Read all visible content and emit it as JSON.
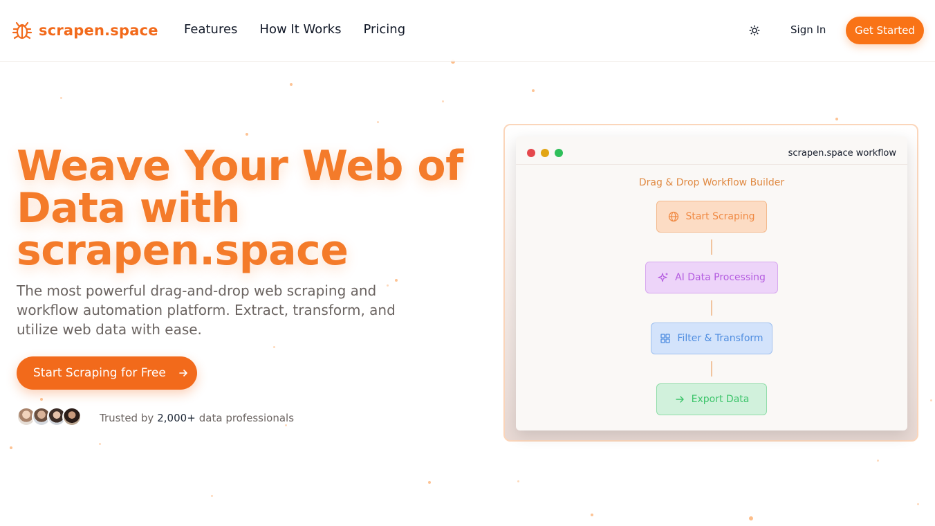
{
  "brand": {
    "name": "scrapen.space",
    "logo_icon": "bug-icon",
    "accent_color": "#f97316"
  },
  "nav": {
    "items": [
      {
        "label": "Features"
      },
      {
        "label": "How It Works"
      },
      {
        "label": "Pricing"
      }
    ]
  },
  "header_actions": {
    "theme_icon": "sun-icon",
    "sign_in_label": "Sign In",
    "get_started_label": "Get Started"
  },
  "hero": {
    "title_line1": "Weave Your Web of",
    "title_line2": "Data with",
    "title_line3": "scrapen.space",
    "subtitle": "The most powerful drag-and-drop web scraping and workflow automation platform. Extract, transform, and utilize web data with ease.",
    "cta_label": "Start Scraping for Free",
    "cta_icon": "arrow-right-icon",
    "trusted_prefix": "Trusted by",
    "trusted_count": "2,000+",
    "trusted_suffix": "data professionals"
  },
  "preview": {
    "window_title": "scrapen.space workflow",
    "builder_title": "Drag & Drop Workflow Builder",
    "window_dot_colors": [
      "#e5484d",
      "#e2a514",
      "#2fbf5a"
    ],
    "nodes": [
      {
        "label": "Start Scraping",
        "icon": "globe-icon",
        "color": "#f08a44"
      },
      {
        "label": "AI Data Processing",
        "icon": "sparkles-icon",
        "color": "#b45ce0"
      },
      {
        "label": "Filter & Transform",
        "icon": "grid-icon",
        "color": "#4f8de0"
      },
      {
        "label": "Export Data",
        "icon": "arrow-right-icon",
        "color": "#3cc46a"
      }
    ]
  }
}
